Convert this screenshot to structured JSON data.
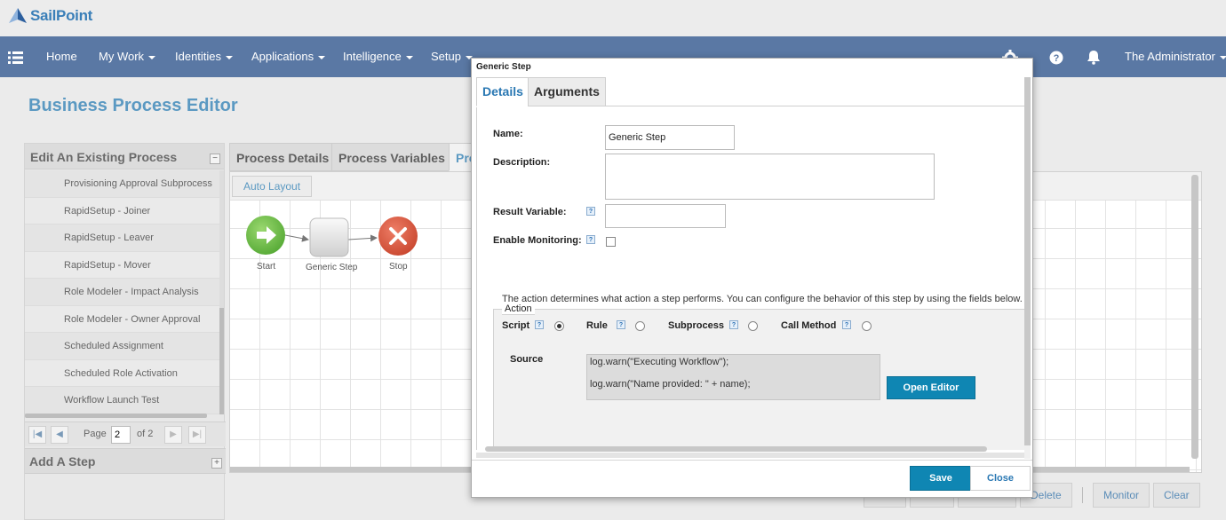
{
  "brand": {
    "name": "SailPoint"
  },
  "nav": {
    "items": [
      {
        "label": "Home",
        "dropdown": false
      },
      {
        "label": "My Work",
        "dropdown": true
      },
      {
        "label": "Identities",
        "dropdown": true
      },
      {
        "label": "Applications",
        "dropdown": true
      },
      {
        "label": "Intelligence",
        "dropdown": true
      },
      {
        "label": "Setup",
        "dropdown": true
      }
    ],
    "user": "The Administrator"
  },
  "page": {
    "title": "Business Process Editor"
  },
  "left": {
    "edit_title": "Edit An Existing Process",
    "processes": [
      "Provisioning Approval Subprocess",
      "RapidSetup - Joiner",
      "RapidSetup - Leaver",
      "RapidSetup - Mover",
      "Role Modeler - Impact Analysis",
      "Role Modeler - Owner Approval",
      "Scheduled Assignment",
      "Scheduled Role Activation",
      "Workflow Launch Test"
    ],
    "pager": {
      "page_label": "Page",
      "page_value": "2",
      "of_label": "of 2"
    },
    "add_step_title": "Add A Step"
  },
  "center": {
    "tabs": [
      "Process Details",
      "Process Variables",
      "Pro"
    ],
    "auto_layout": "Auto Layout",
    "nodes": [
      {
        "label": "Start",
        "color": "#6cbf4a"
      },
      {
        "label": "Generic Step",
        "color": "#dcdcdc"
      },
      {
        "label": "Stop",
        "color": "#d9583f"
      }
    ]
  },
  "bottom_buttons": [
    "Delete",
    "Monitor",
    "Clear"
  ],
  "dialog": {
    "title": "Generic Step",
    "tabs": [
      "Details",
      "Arguments"
    ],
    "fields": {
      "name_label": "Name:",
      "name_value": "Generic Step",
      "description_label": "Description:",
      "description_value": "",
      "result_variable_label": "Result Variable:",
      "result_variable_value": "",
      "enable_monitoring_label": "Enable Monitoring:",
      "enable_monitoring_checked": false
    },
    "action": {
      "legend": "Action",
      "description": "The action determines what action a step performs. You can configure the behavior of this step by using the fields below.",
      "options": [
        {
          "label": "Script",
          "selected": true
        },
        {
          "label": "Rule",
          "selected": false
        },
        {
          "label": "Subprocess",
          "selected": false
        },
        {
          "label": "Call Method",
          "selected": false
        }
      ],
      "source_label": "Source",
      "source_lines": [
        "log.warn(\"Executing Workflow\");",
        "log.warn(\"Name provided: \" + name);"
      ],
      "open_editor": "Open Editor"
    },
    "save": "Save",
    "close": "Close",
    "help_glyph": "?"
  },
  "colors": {
    "nav_bg": "#5a78a4",
    "accent": "#0f86b3",
    "title": "#5b99c2"
  }
}
